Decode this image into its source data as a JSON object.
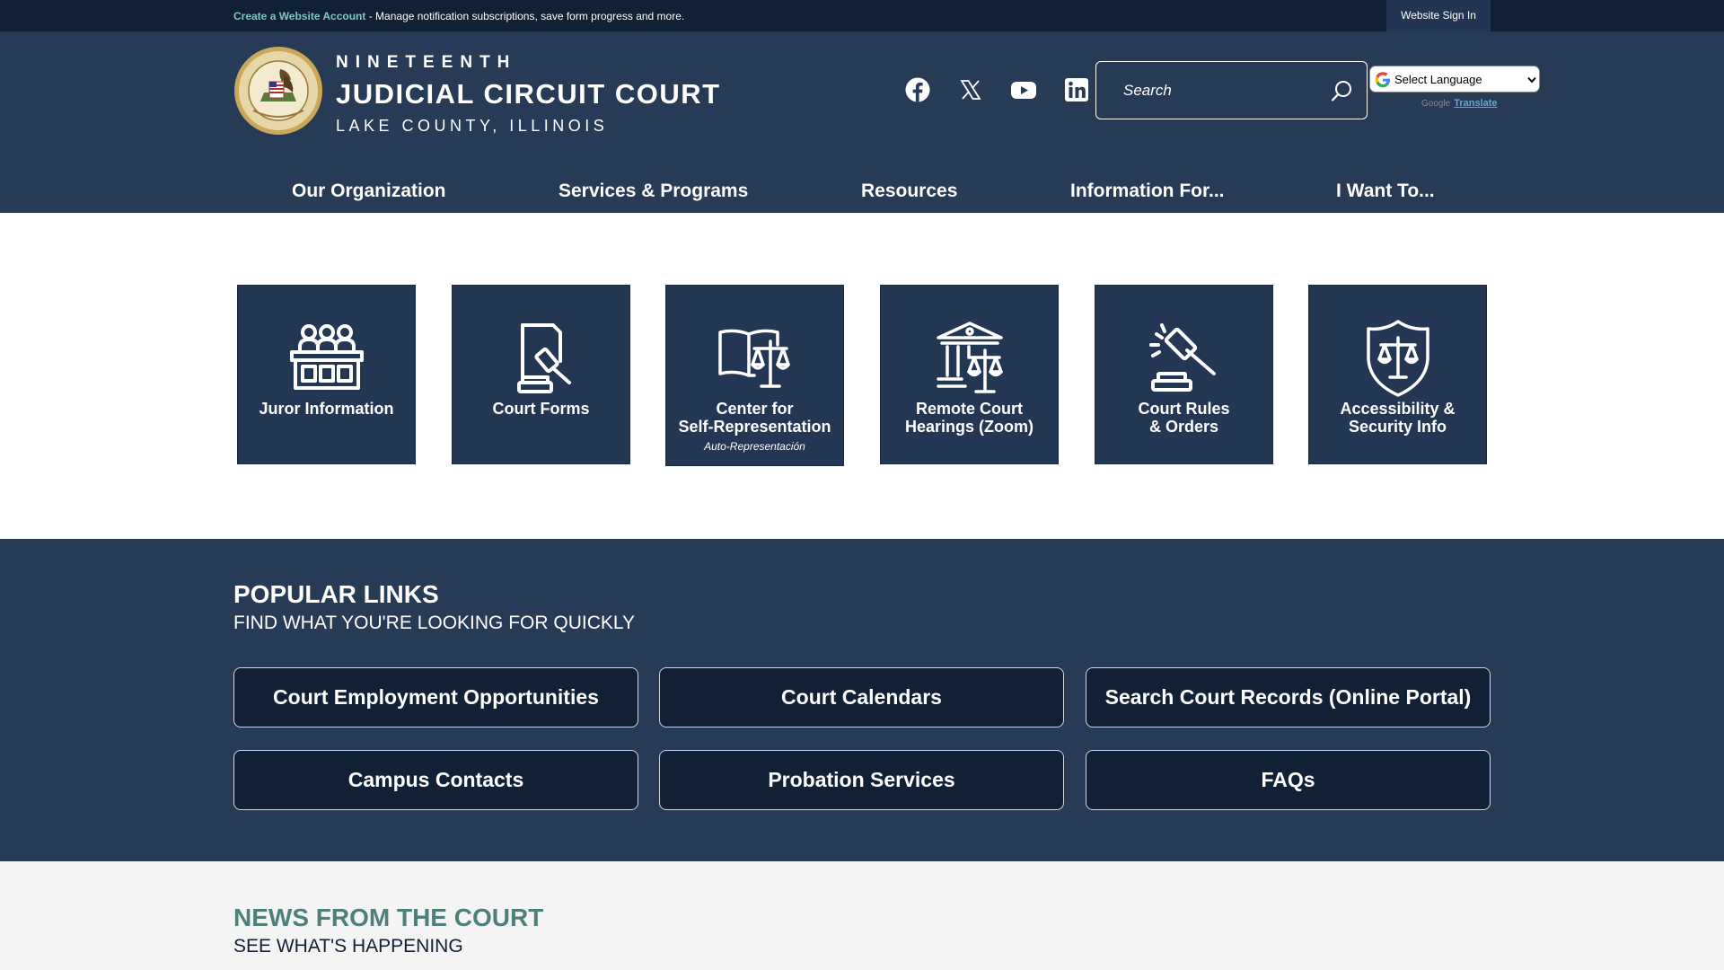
{
  "topbar": {
    "create_account_link": "Create a Website Account",
    "account_message": "- Manage notification subscriptions, save form progress and more.",
    "sign_in": "Website Sign In"
  },
  "logo": {
    "line1": "NINETEENTH",
    "line2": "JUDICIAL CIRCUIT COURT",
    "line3": "LAKE COUNTY, ILLINOIS"
  },
  "social": {
    "items": [
      {
        "icon": "facebook-icon"
      },
      {
        "icon": "x-twitter-icon"
      },
      {
        "icon": "youtube-icon"
      },
      {
        "icon": "linkedin-icon"
      }
    ]
  },
  "search": {
    "placeholder": "Search"
  },
  "language": {
    "selected": "Select Language",
    "powered_by": "Google",
    "translate_link": "Translate"
  },
  "nav": {
    "items": [
      {
        "label": "Our Organization"
      },
      {
        "label": "Services & Programs"
      },
      {
        "label": "Resources"
      },
      {
        "label": "Information For..."
      },
      {
        "label": "I Want To..."
      }
    ]
  },
  "tiles": [
    {
      "line1": "Juror Information",
      "line2": "",
      "sub": "",
      "icon": "jury-box-icon"
    },
    {
      "line1": "Court Forms",
      "line2": "",
      "sub": "",
      "icon": "document-gavel-icon"
    },
    {
      "line1": "Center for",
      "line2": "Self-Representation",
      "sub": "Auto-Representación",
      "icon": "book-scales-icon"
    },
    {
      "line1": "Remote Court",
      "line2": "Hearings (Zoom)",
      "sub": "",
      "icon": "courthouse-scales-icon"
    },
    {
      "line1": "Court Rules",
      "line2": "& Orders",
      "sub": "",
      "icon": "gavel-icon"
    },
    {
      "line1": "Accessibility &",
      "line2": "Security Info",
      "sub": "",
      "icon": "shield-scales-icon"
    }
  ],
  "popular": {
    "title": "POPULAR LINKS",
    "subtitle": "FIND WHAT YOU'RE LOOKING FOR QUICKLY",
    "links": [
      {
        "label": "Court Employment Opportunities"
      },
      {
        "label": "Court Calendars"
      },
      {
        "label": "Search Court Records (Online Portal)"
      },
      {
        "label": "Campus Contacts"
      },
      {
        "label": "Probation Services"
      },
      {
        "label": "FAQs"
      }
    ]
  },
  "news": {
    "title": "NEWS FROM THE COURT",
    "subtitle": "SEE WHAT'S HAPPENING"
  },
  "colors": {
    "topbar": "#122036",
    "header": "#273a56",
    "accent_teal": "#4f7f7b",
    "tile": "#233654"
  }
}
